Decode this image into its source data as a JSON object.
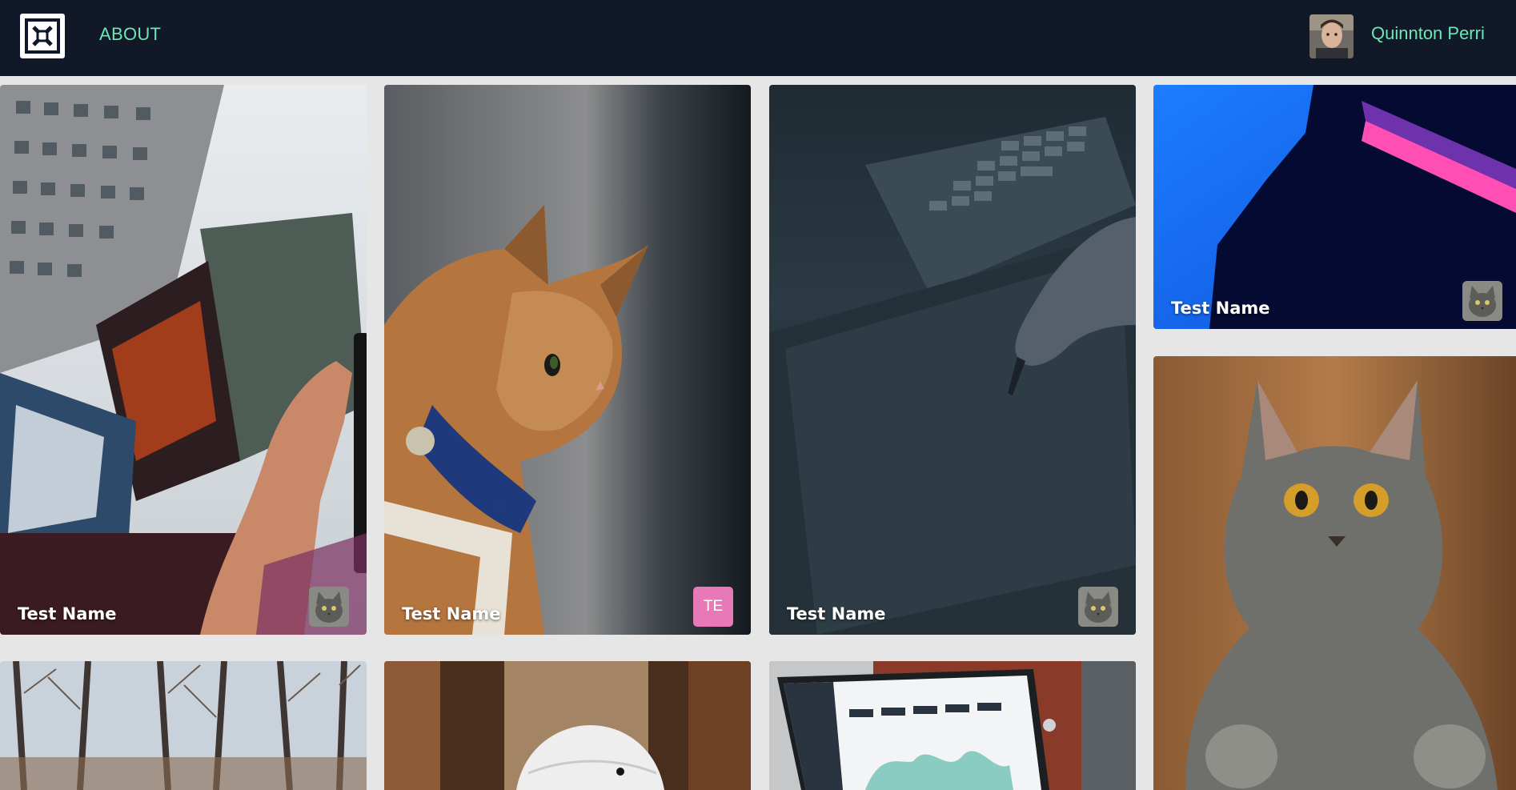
{
  "header": {
    "logo_icon": "framed-x-logo-icon",
    "nav_about_label": "ABOUT",
    "user_name": "Quinnton Perri",
    "accent_color": "#6ee7b7",
    "background_color": "#111827"
  },
  "gallery": {
    "background_color": "#e6e6e6",
    "cards": [
      {
        "caption": "Test Name",
        "badge": {
          "type": "image",
          "icon": "cat-avatar-icon"
        },
        "photo": "city-phone-photo"
      },
      {
        "caption": "Test Name",
        "badge": {
          "type": "initials",
          "text": "TE",
          "color": "#e879b9"
        },
        "photo": "ginger-cat-photo"
      },
      {
        "caption": "Test Name",
        "badge": {
          "type": "image",
          "icon": "cat-avatar-icon"
        },
        "photo": "drawing-tablet-photo"
      },
      {
        "caption": "Test Name",
        "badge": {
          "type": "image",
          "icon": "cat-avatar-icon"
        },
        "photo": "silhouette-neon-photo"
      },
      {
        "caption": "",
        "photo": "grey-kitten-photo"
      },
      {
        "caption": "",
        "photo": "bare-trees-photo"
      },
      {
        "caption": "",
        "photo": "white-robot-photo"
      },
      {
        "caption": "",
        "photo": "laptop-dashboard-photo"
      }
    ]
  }
}
